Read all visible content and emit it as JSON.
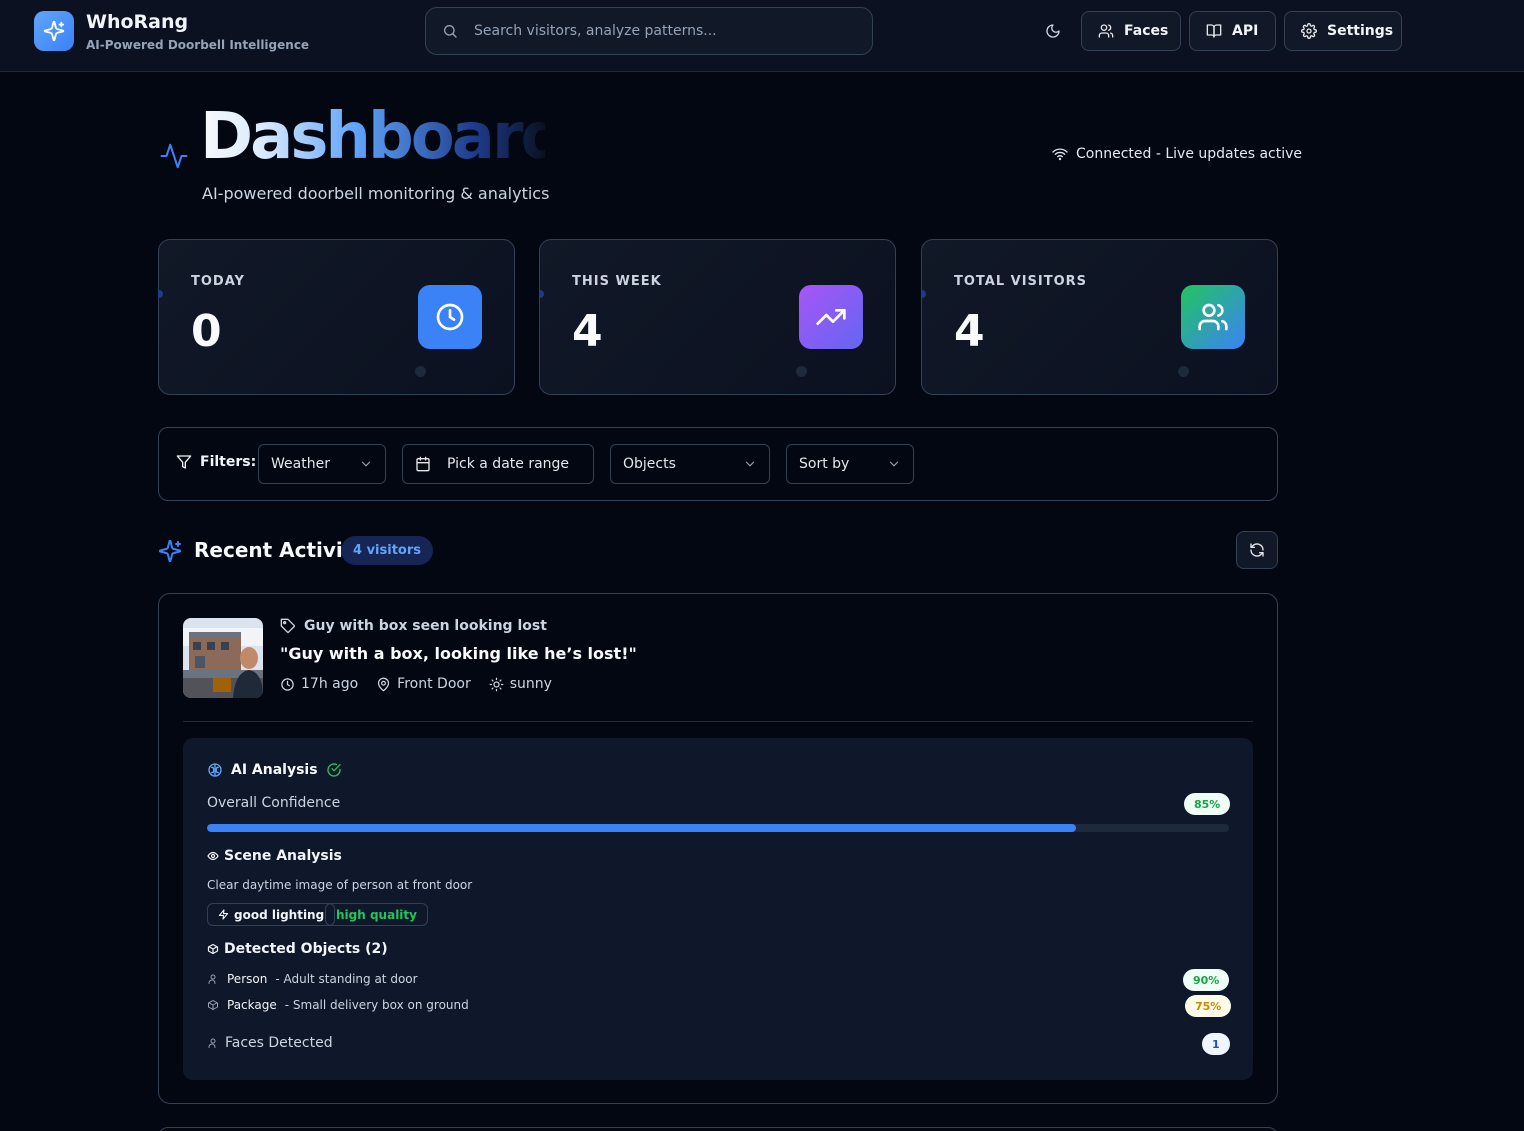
{
  "header": {
    "brand_name": "WhoRang",
    "brand_tagline": "AI-Powered Doorbell Intelligence",
    "search_placeholder": "Search visitors, analyze patterns...",
    "buttons": {
      "faces": "Faces",
      "api": "API",
      "settings": "Settings"
    }
  },
  "page": {
    "title": "Dashboard",
    "subtitle": "AI-powered doorbell monitoring & analytics",
    "connection_status": "Connected - Live updates active"
  },
  "stats": [
    {
      "label": "TODAY",
      "value": "0",
      "icon": "clock-icon",
      "color": "#3b82f6"
    },
    {
      "label": "THIS WEEK",
      "value": "4",
      "icon": "trending-up-icon",
      "color": "#8b5cf6"
    },
    {
      "label": "TOTAL VISITORS",
      "value": "4",
      "icon": "users-icon",
      "color": "#10b981"
    }
  ],
  "filters": {
    "label": "Filters:",
    "weather": "Weather",
    "date_range": "Pick a date range",
    "objects": "Objects",
    "sort_by": "Sort by"
  },
  "recent_activity": {
    "title": "Recent Activity",
    "count_badge": "4 visitors"
  },
  "visit": {
    "tag": "Guy with box seen looking lost",
    "quote": "\"Guy with a box, looking like he’s lost!\"",
    "time_ago": "17h ago",
    "location": "Front Door",
    "weather": "sunny",
    "ai_analysis": {
      "title": "AI Analysis",
      "confidence_label": "Overall Confidence",
      "confidence_text": "85%",
      "confidence_value": 0.85,
      "scene_title": "Scene Analysis",
      "scene_description": "Clear daytime image of person at front door",
      "scene_tags": [
        "good lighting",
        "high quality"
      ],
      "objects_title": "Detected Objects (2)",
      "objects": [
        {
          "name": "Person",
          "description": "- Adult standing at door",
          "confidence": "90%"
        },
        {
          "name": "Package",
          "description": "- Small delivery box on ground",
          "confidence": "75%"
        }
      ],
      "faces_label": "Faces Detected",
      "faces_count": "1"
    }
  }
}
